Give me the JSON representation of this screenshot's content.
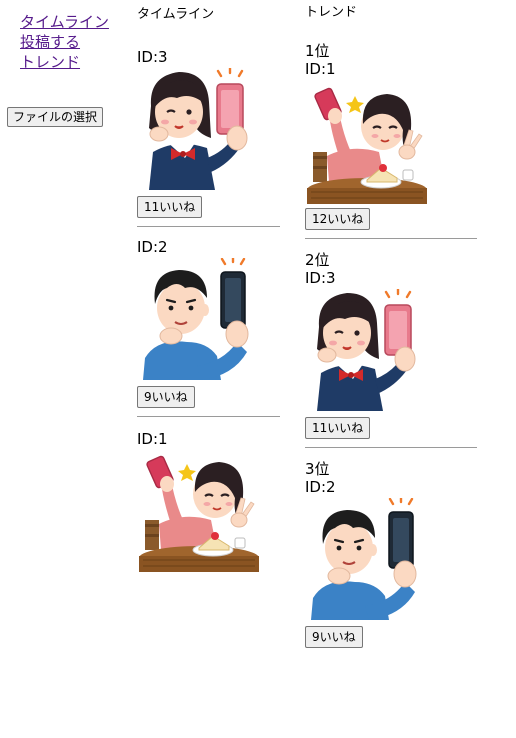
{
  "nav": {
    "timeline": "タイムライン",
    "post": "投稿する",
    "trend": "トレンド"
  },
  "file_button": "ファイルの選択",
  "timeline": {
    "header": "タイムライン",
    "posts": [
      {
        "id_label": "ID:3",
        "like_label": "11いいね",
        "image": "girl-selfie-peace-sign-illustration"
      },
      {
        "id_label": "ID:2",
        "like_label": "9いいね",
        "image": "boy-selfie-illustration"
      },
      {
        "id_label": "ID:1",
        "image": "girl-selfie-with-cake-illustration"
      }
    ]
  },
  "trend": {
    "header": "トレンド",
    "posts": [
      {
        "rank": "1位",
        "id_label": "ID:1",
        "like_label": "12いいね",
        "image": "girl-selfie-with-cake-illustration"
      },
      {
        "rank": "2位",
        "id_label": "ID:3",
        "like_label": "11いいね",
        "image": "girl-selfie-peace-sign-illustration"
      },
      {
        "rank": "3位",
        "id_label": "ID:2",
        "like_label": "9いいね",
        "image": "boy-selfie-illustration"
      }
    ]
  },
  "colors": {
    "link": "#551a8b",
    "button_bg": "#efefef",
    "divider": "#9a9a9a"
  }
}
